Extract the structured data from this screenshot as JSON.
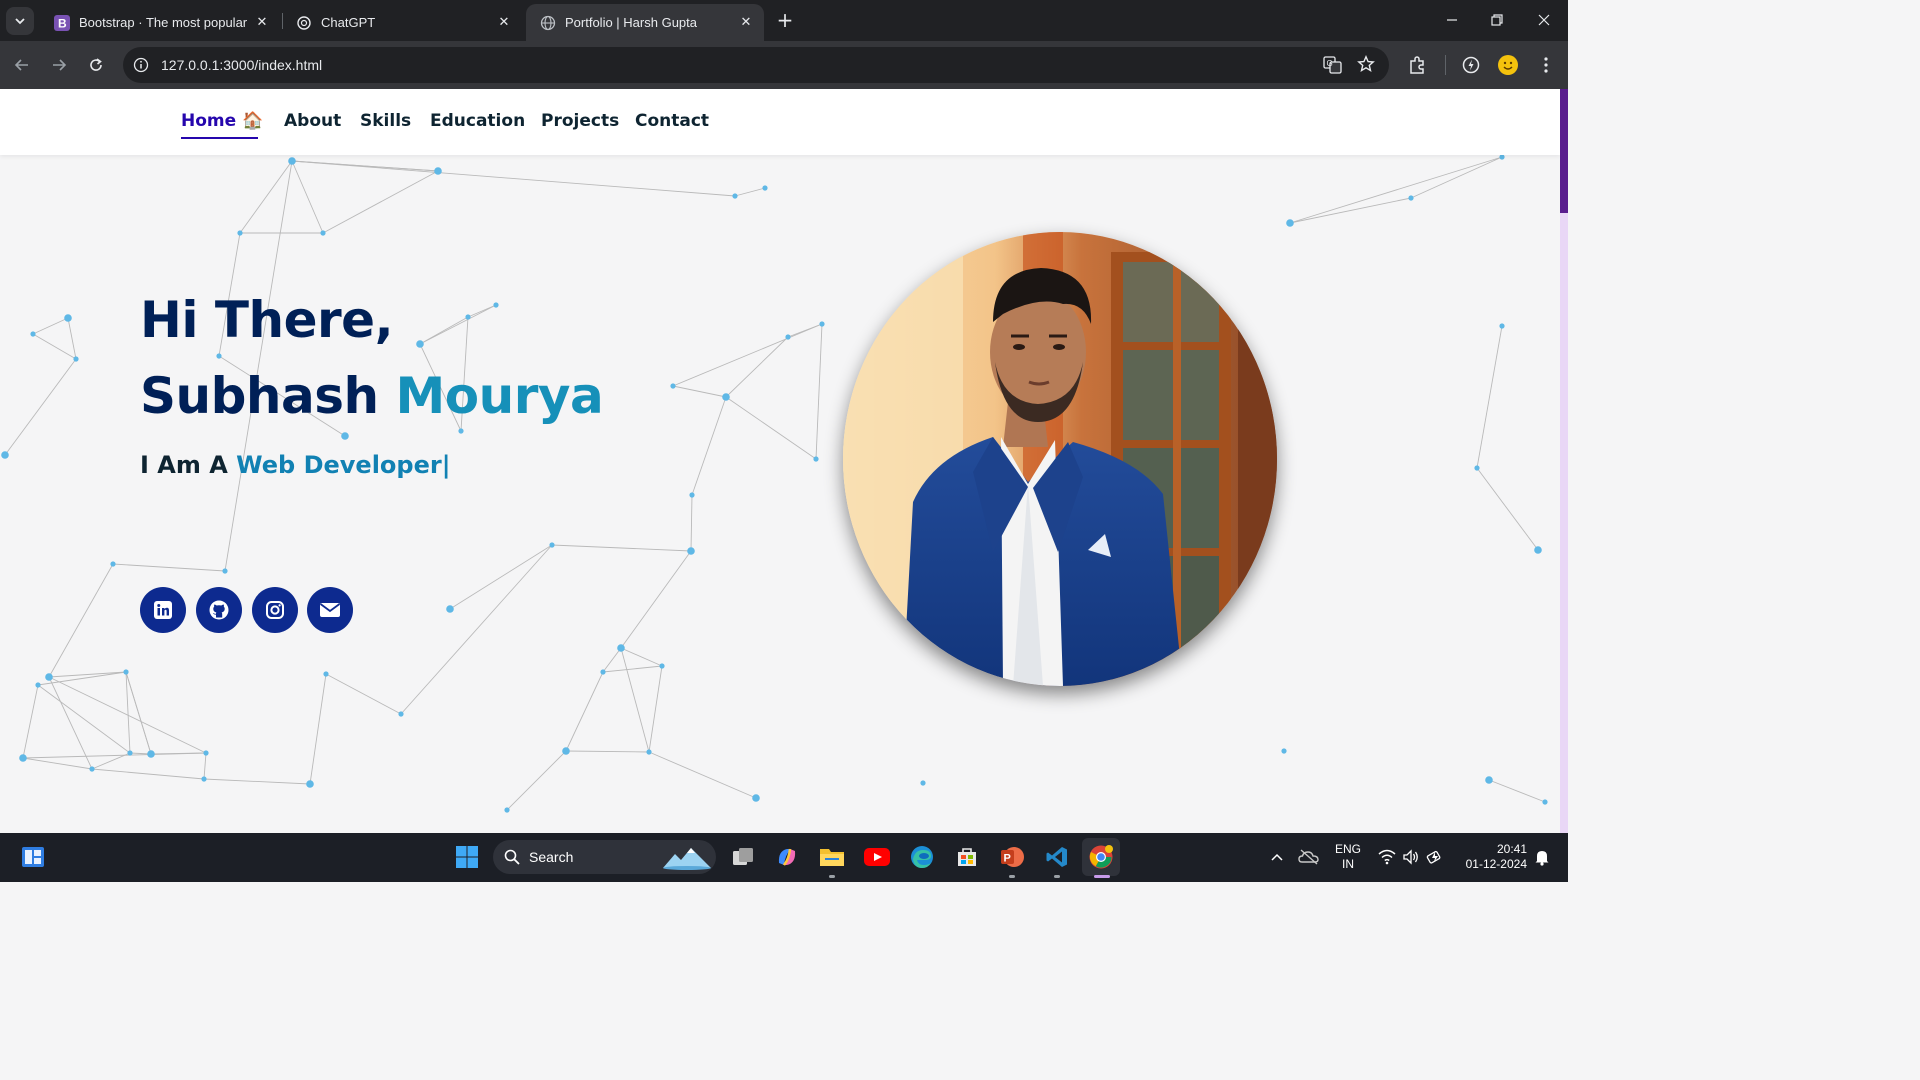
{
  "browser": {
    "tabs": [
      {
        "title": "Bootstrap · The most popular HTML, CSS, and JS library",
        "favicon": "bootstrap-icon",
        "active": false
      },
      {
        "title": "ChatGPT",
        "favicon": "chatgpt-icon",
        "active": false
      },
      {
        "title": "Portfolio | Harsh Gupta",
        "favicon": "globe-icon",
        "active": true
      }
    ],
    "url": "127.0.0.1:3000/index.html"
  },
  "navbar": {
    "items": [
      {
        "label": "Home 🏠",
        "active": true
      },
      {
        "label": "About"
      },
      {
        "label": "Skills"
      },
      {
        "label": "Education"
      },
      {
        "label": "Projects"
      },
      {
        "label": "Contact"
      }
    ]
  },
  "hero": {
    "greeting": "Hi There,",
    "first_name": "Subhash",
    "last_name": "Mourya",
    "tagline_prefix": "I Am A",
    "tagline_typed": "Web Developer|",
    "social": [
      "linkedin-icon",
      "github-icon",
      "instagram-icon",
      "email-icon"
    ]
  },
  "taskbar": {
    "search_label": "Search",
    "language": "ENG",
    "region": "IN",
    "time": "20:41",
    "date": "01-12-2024"
  },
  "colors": {
    "navy": "#002057",
    "accent": "#1690b9",
    "nav_active": "#2506ad",
    "social_bg": "#0d2a8f"
  }
}
